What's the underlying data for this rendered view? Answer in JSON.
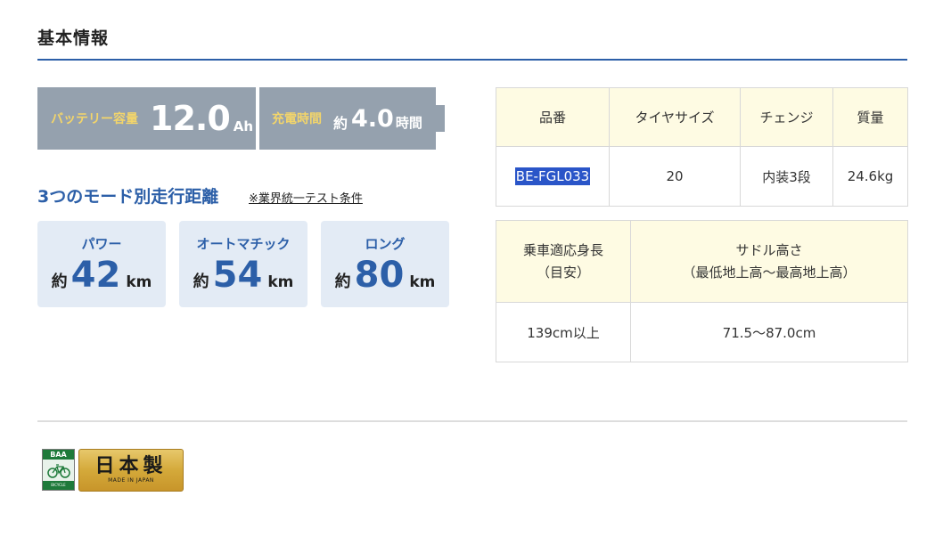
{
  "section": {
    "title": "基本情報"
  },
  "spec": {
    "battery_label": "バッテリー容量",
    "battery_value": "12.0",
    "battery_unit": "Ah",
    "charge_label": "充電時間",
    "charge_approx": "約",
    "charge_value": "4.0",
    "charge_unit": "時間"
  },
  "modes": {
    "heading": "3つのモード別走行距離",
    "note": "※業界統一テスト条件",
    "items": [
      {
        "name": "パワー",
        "approx": "約",
        "value": "42",
        "unit": "km"
      },
      {
        "name": "オートマチック",
        "approx": "約",
        "value": "54",
        "unit": "km"
      },
      {
        "name": "ロング",
        "approx": "約",
        "value": "80",
        "unit": "km"
      }
    ]
  },
  "table1": {
    "headers": [
      "品番",
      "タイヤサイズ",
      "チェンジ",
      "質量"
    ],
    "row": [
      "BE-FGL033",
      "20",
      "内装3段",
      "24.6kg"
    ]
  },
  "table2": {
    "header_height_line1": "乗車適応身長",
    "header_height_line2": "（目安）",
    "header_saddle_line1": "サドル高さ",
    "header_saddle_line2": "（最低地上高〜最高地上高）",
    "row": [
      "139cm以上",
      "71.5〜87.0cm"
    ]
  },
  "badges": {
    "baa_top": "BAA",
    "baa_bottom": "BICYCLE ASSOCIATION",
    "japan_main": "日本製",
    "japan_sub": "MADE IN JAPAN"
  },
  "colors": {
    "accent_blue": "#2c5fa8",
    "spec_gray": "#95a1ae",
    "spec_label_yellow": "#f3d56a",
    "mode_card_bg": "#e3ebf5",
    "table_header_bg": "#fefbe3",
    "selection_blue": "#2a55c8",
    "gold": "#d4a93a"
  }
}
